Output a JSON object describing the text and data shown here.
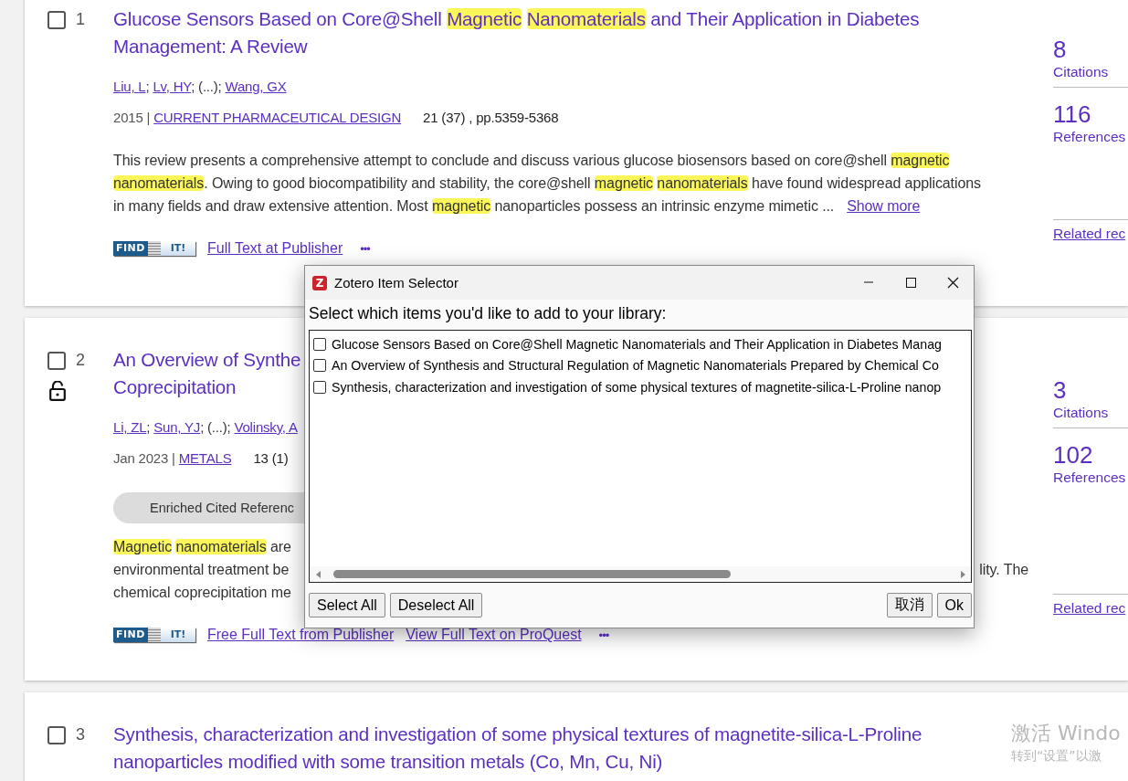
{
  "records": [
    {
      "number": "1",
      "selected": false,
      "open_access": false,
      "title_lines": [
        [
          {
            "text": "Glucose Sensors Based on Core@Shell ",
            "kind": "text"
          },
          {
            "text": "Magnetic ",
            "kind": "highlight"
          },
          {
            "text": "Nanomaterials",
            "kind": "highlight"
          },
          {
            "text": " and Their Application in Diabetes",
            "kind": "text"
          }
        ],
        [
          {
            "text": "Management: A Review",
            "kind": "text"
          }
        ]
      ],
      "authors": [
        {
          "text": "Liu, L",
          "kind": "link"
        },
        {
          "text": "; ",
          "kind": "text"
        },
        {
          "text": "Lv, HY",
          "kind": "link"
        },
        {
          "text": "; (...); ",
          "kind": "text"
        },
        {
          "text": "Wang, GX",
          "kind": "link"
        }
      ],
      "source": [
        {
          "text": "2015 | ",
          "kind": "muted"
        },
        {
          "text": "CURRENT PHARMACEUTICAL DESIGN",
          "kind": "link"
        }
      ],
      "volume": "21 (37) , pp.5359-5368",
      "abstract_lines": [
        {
          "segments": [
            {
              "text": "This review presents a comprehensive attempt to conclude and discuss various glucose biosensors based on core@shell ",
              "kind": "text"
            },
            {
              "text": "magnetic",
              "kind": "highlight"
            }
          ]
        },
        {
          "segments": [
            {
              "text": "nanomaterials",
              "kind": "highlight"
            },
            {
              "text": ". Owing to good biocompatibility and stability, the core@shell ",
              "kind": "text"
            },
            {
              "text": "magnetic ",
              "kind": "highlight"
            },
            {
              "text": "nanomaterials",
              "kind": "highlight"
            },
            {
              "text": " have found widespread applications",
              "kind": "text"
            }
          ]
        },
        {
          "segments": [
            {
              "text": "in many fields and draw extensive attention. Most ",
              "kind": "text"
            },
            {
              "text": "magnetic",
              "kind": "highlight"
            },
            {
              "text": " nanoparticles possess an intrinsic enzyme mimetic ...",
              "kind": "text"
            },
            {
              "text": "Show more",
              "kind": "link"
            }
          ]
        }
      ],
      "find_it": {
        "left": "FIND",
        "right": "IT!"
      },
      "links": [
        "Full Text at Publisher"
      ],
      "more": "•••",
      "metrics": [
        {
          "value": "8",
          "label": "Citations"
        },
        {
          "value": "116",
          "label": "References"
        }
      ],
      "related": "Related rec"
    },
    {
      "number": "2",
      "selected": false,
      "open_access": true,
      "title_lines": [
        [
          {
            "text": "An Overview of Synthe",
            "kind": "text"
          }
        ],
        [
          {
            "text": "Coprecipitation",
            "kind": "text"
          }
        ]
      ],
      "authors": [
        {
          "text": "Li, ZL",
          "kind": "link"
        },
        {
          "text": "; ",
          "kind": "text"
        },
        {
          "text": "Sun, YJ",
          "kind": "link"
        },
        {
          "text": "; (...); ",
          "kind": "text"
        },
        {
          "text": "Volinsky, A",
          "kind": "link"
        }
      ],
      "source": [
        {
          "text": "Jan 2023 | ",
          "kind": "muted"
        },
        {
          "text": "METALS",
          "kind": "link"
        }
      ],
      "volume": "13 (1)",
      "pill": "Enriched Cited Referenc",
      "abstract_lines": [
        {
          "segments": [
            {
              "text": "Magnetic ",
              "kind": "highlight"
            },
            {
              "text": "nanomaterials",
              "kind": "highlight"
            },
            {
              "text": " are",
              "kind": "text"
            }
          ]
        },
        {
          "segments": [
            {
              "text": "environmental treatment be",
              "kind": "text"
            }
          ],
          "right_segments": [
            {
              "text": "lity. The",
              "kind": "text"
            }
          ]
        },
        {
          "segments": [
            {
              "text": "chemical coprecipitation me",
              "kind": "text"
            }
          ]
        }
      ],
      "find_it": {
        "left": "FIND",
        "right": "IT!"
      },
      "links": [
        "Free Full Text from Publisher",
        "View Full Text on ProQuest"
      ],
      "more": "•••",
      "metrics": [
        {
          "value": "3",
          "label": "Citations"
        },
        {
          "value": "102",
          "label": "References"
        }
      ],
      "related": "Related rec"
    },
    {
      "number": "3",
      "selected": false,
      "open_access": false,
      "title_lines": [
        [
          {
            "text": "Synthesis, characterization and investigation of some physical textures of magnetite-silica-L-Proline",
            "kind": "text"
          }
        ],
        [
          {
            "text": "nanoparticles modified with some transition metals (Co, Mn, Cu, Ni)",
            "kind": "text"
          }
        ]
      ]
    }
  ],
  "dialog": {
    "icon_letter": "Z",
    "title": "Zotero Item Selector",
    "prompt": "Select which items you'd like to add to your library:",
    "items": [
      {
        "label": "Glucose Sensors Based on Core@Shell Magnetic Nanomaterials and Their Application in Diabetes Manag",
        "checked": false
      },
      {
        "label": "An Overview of Synthesis and Structural Regulation of Magnetic Nanomaterials Prepared by Chemical Co",
        "checked": false
      },
      {
        "label": "Synthesis, characterization and investigation of some physical textures of magnetite-silica-L-Proline nanop",
        "checked": false
      }
    ],
    "buttons_left": [
      "Select All",
      "Deselect All"
    ],
    "buttons_right": [
      "取消",
      "Ok"
    ]
  },
  "activation_notice": {
    "title": "激活 Windo",
    "subtitle": "转到“设置”以激"
  }
}
